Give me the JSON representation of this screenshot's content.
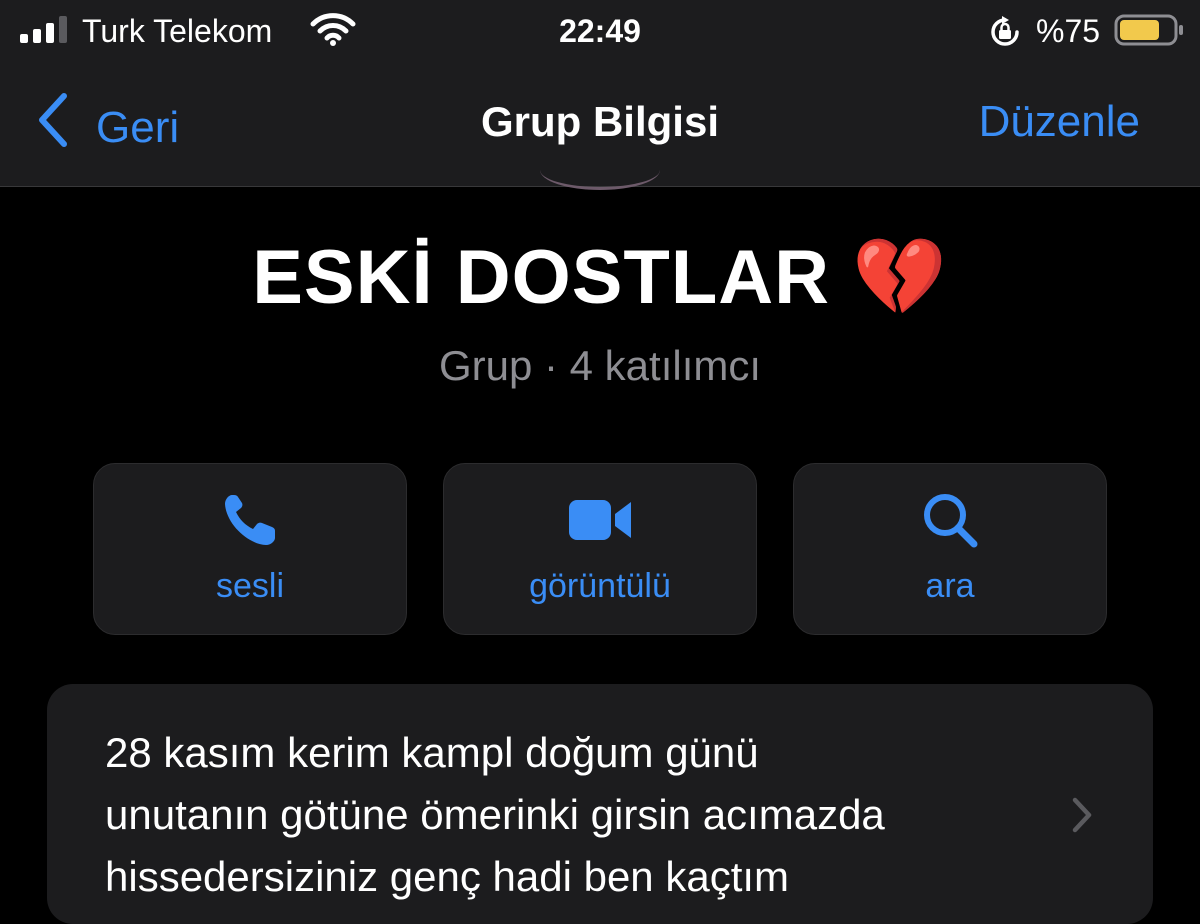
{
  "status_bar": {
    "carrier": "Turk Telekom",
    "time": "22:49",
    "battery_percent": "%75",
    "battery_level": 0.75,
    "signal_bars": 3,
    "icons": [
      "signal-icon",
      "wifi-icon",
      "orientation-lock-icon",
      "battery-icon"
    ]
  },
  "nav": {
    "back_label": "Geri",
    "title": "Grup Bilgisi",
    "edit_label": "Düzenle"
  },
  "group": {
    "name": "ESKİ DOSTLAR 💔",
    "meta": "Grup · 4 katılımcı"
  },
  "actions": [
    {
      "label": "sesli",
      "icon": "phone-icon"
    },
    {
      "label": "görüntülü",
      "icon": "video-camera-icon"
    },
    {
      "label": "ara",
      "icon": "search-icon"
    }
  ],
  "description": {
    "text": "28 kasım kerim kampl doğum günü\nunutanın götüne ömerinki girsin acımazda\nhissedersiziniz genç hadi ben kaçtım"
  },
  "colors": {
    "accent": "#3a8df5",
    "background": "#000000",
    "surface": "#1c1c1e",
    "secondary_text": "#8e8e93",
    "battery": "#f2c94c"
  }
}
